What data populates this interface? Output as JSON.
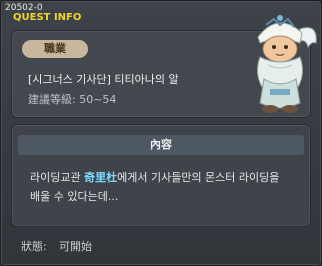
{
  "window": {
    "id": "20502-0",
    "title": "QUEST INFO"
  },
  "quest": {
    "badge": "職業",
    "name": "[시그너스 기사단] 티티아나의 알",
    "level": "建議等級: 50~54"
  },
  "content": {
    "header": "內容",
    "desc_part1": "라이딩교관 ",
    "desc_highlight": "奇里杜",
    "desc_part2": "에게서 기사들만의 몬스터 라이딩을",
    "desc_line2": "배울 수 있다는데..."
  },
  "status": {
    "label": "狀態:",
    "value": "可開始"
  },
  "colors": {
    "title": "#f3d22b",
    "highlight": "#7fd9ff",
    "badge": "#c8b79c"
  },
  "portrait": {
    "icon": "quest-npc-portrait"
  }
}
